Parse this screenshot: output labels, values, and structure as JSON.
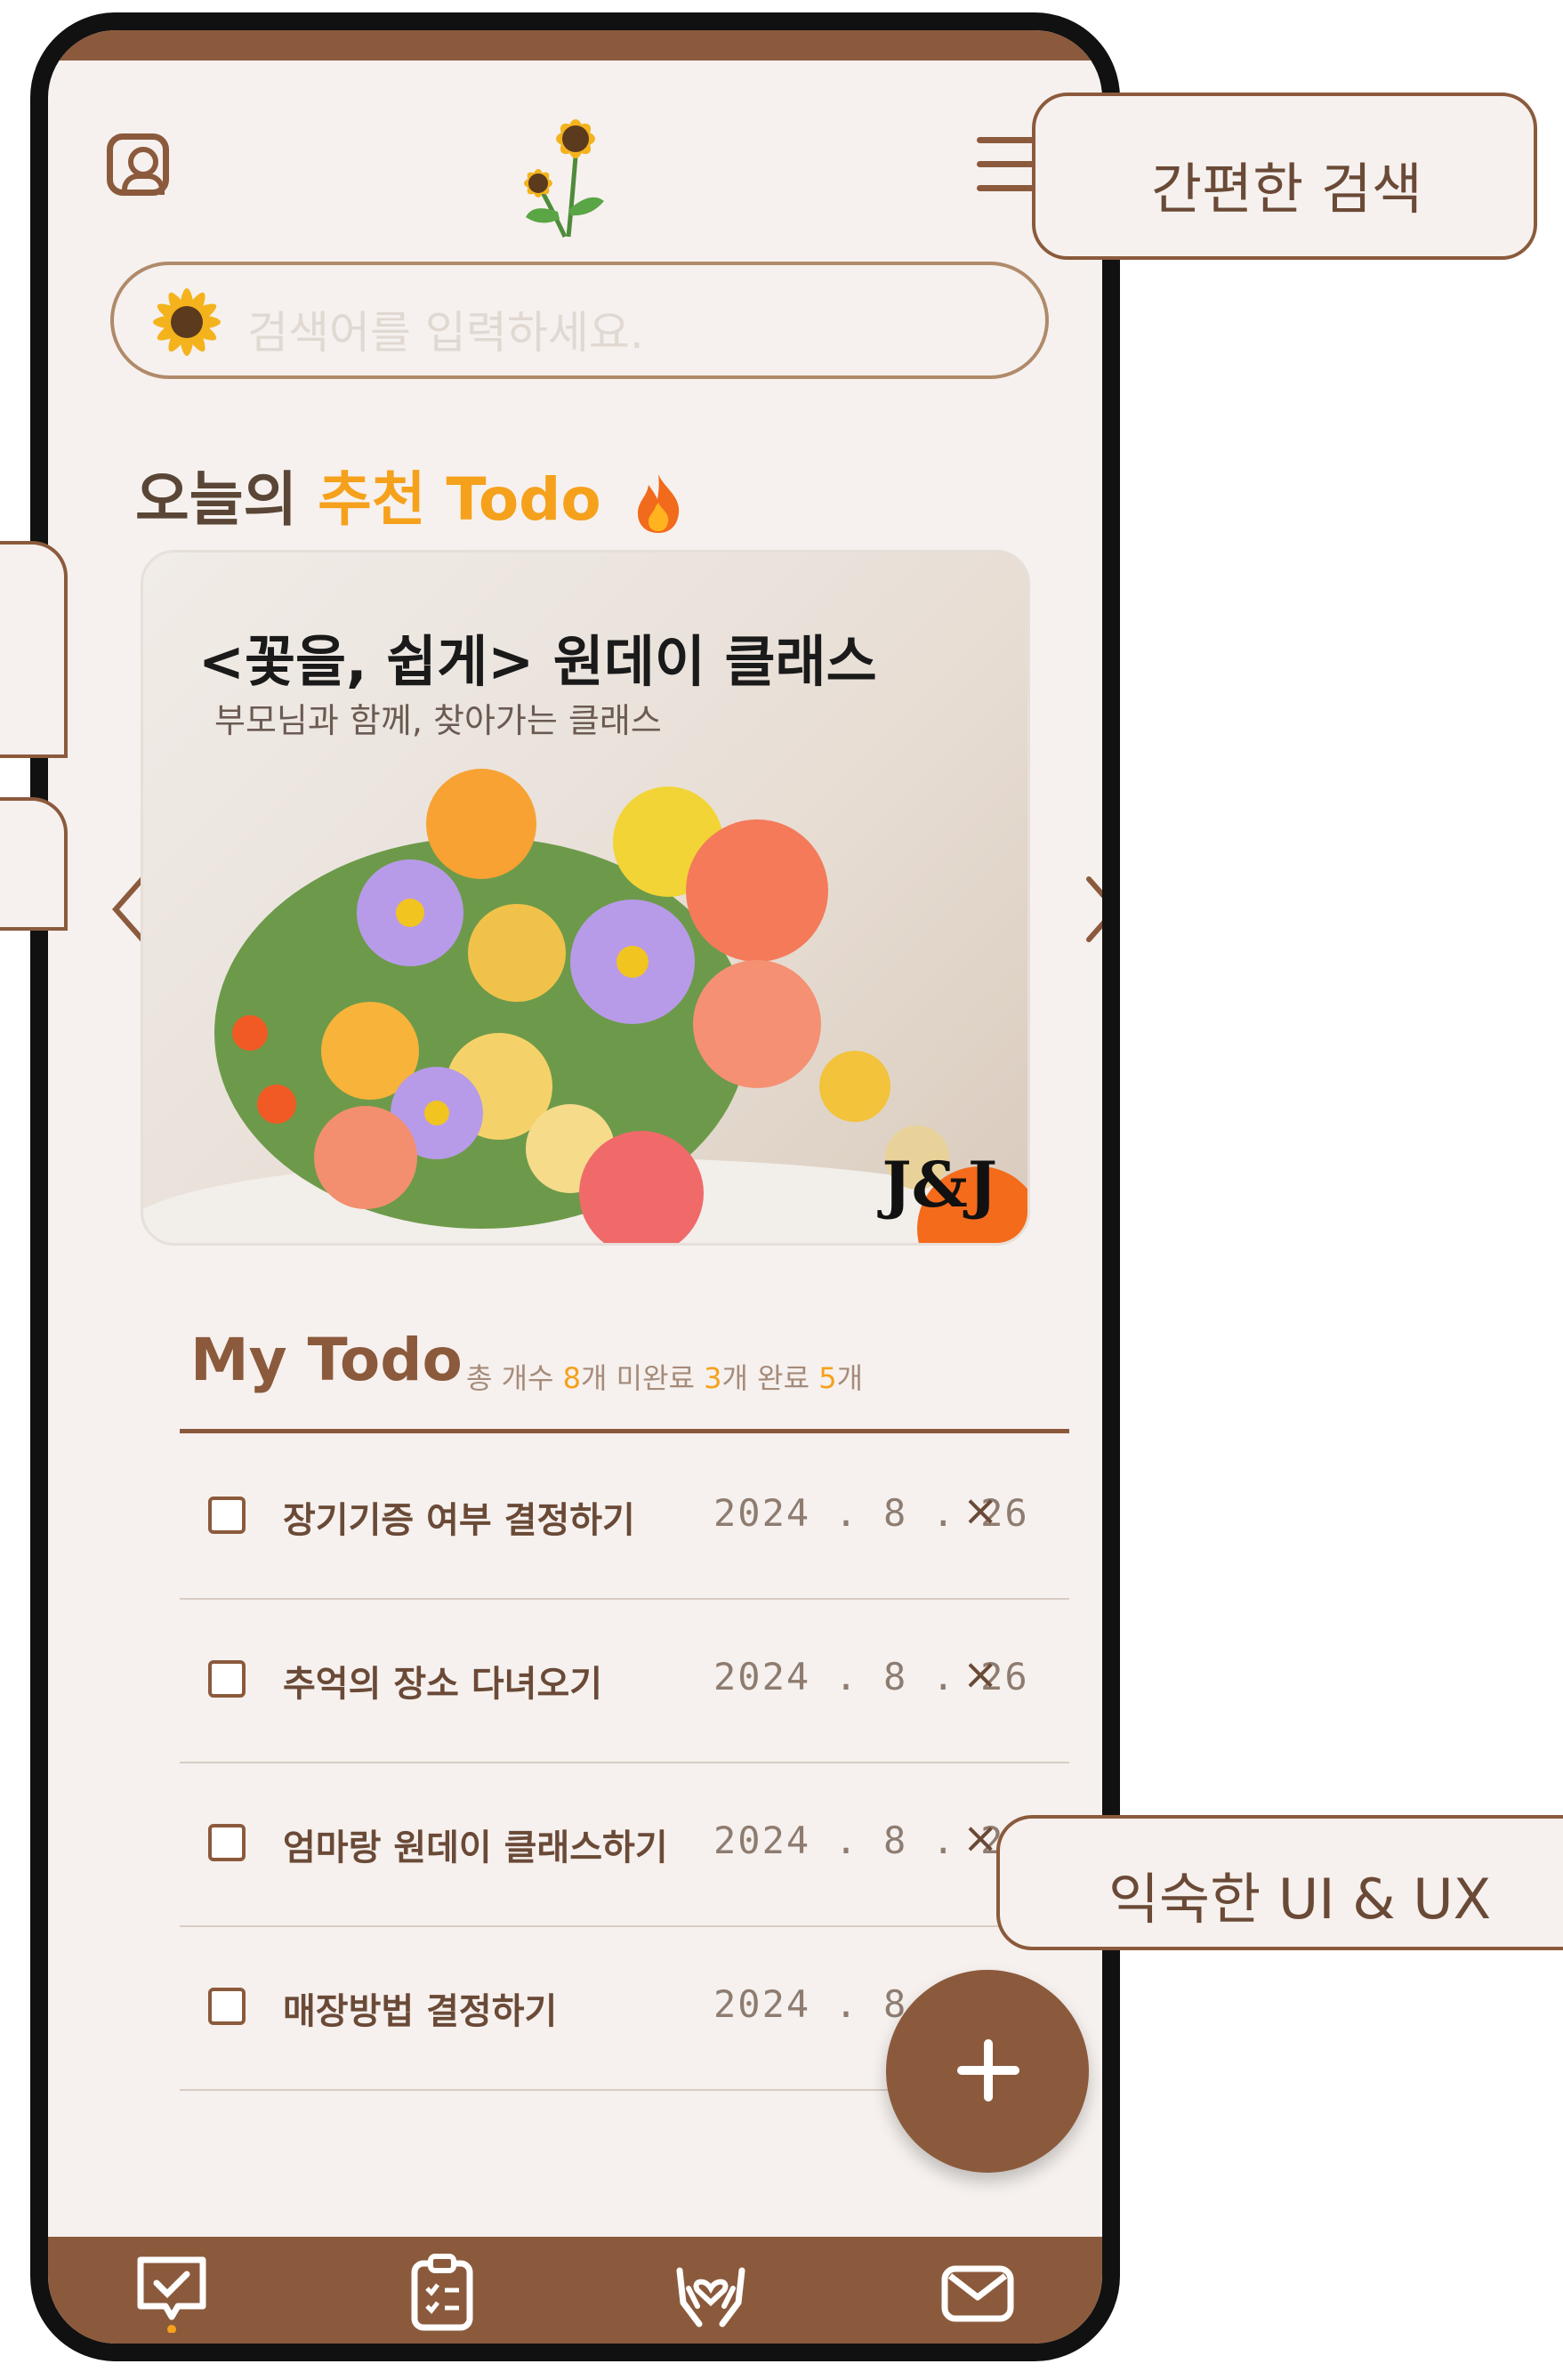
{
  "header": {
    "logo_icon": "sunflower-logo-icon",
    "profile_icon": "profile-icon",
    "menu_icon": "hamburger-menu-icon"
  },
  "search": {
    "placeholder": "검색어를 입력하세요.",
    "icon": "sunflower-search-icon"
  },
  "recommend": {
    "title_prefix": "오늘의 ",
    "title_accent": "추천 Todo",
    "icon": "fire-icon"
  },
  "banner": {
    "title": "<꽃을, 쉽게> 원데이 클래스",
    "subtitle": "부모님과 함께, 찾아가는 클래스",
    "brand": "J&J"
  },
  "my_todo": {
    "title": "My Todo",
    "stats": {
      "total_label": "총 개수",
      "total": "8",
      "unit1": "개",
      "incomplete_label": "미완료",
      "incomplete": "3",
      "unit2": "개",
      "complete_label": "완료",
      "complete": "5",
      "unit3": "개"
    },
    "items": [
      {
        "text": "장기기증 여부 결정하기",
        "date": "2024 . 8 . 26",
        "delete": "×"
      },
      {
        "text": "추억의 장소 다녀오기",
        "date": "2024 . 8 . 26",
        "delete": "×"
      },
      {
        "text": "엄마랑 원데이 클래스하기",
        "date": "2024 . 8 . 26",
        "delete": "×"
      },
      {
        "text": "매장방법 결정하기",
        "date": "2024 . 8 . 2",
        "delete": ""
      }
    ]
  },
  "fab": {
    "icon": "plus-icon"
  },
  "bottom_nav": {
    "items": [
      {
        "icon": "todo-check-icon",
        "active": true
      },
      {
        "icon": "clipboard-list-icon",
        "active": false
      },
      {
        "icon": "heart-hands-icon",
        "active": false
      },
      {
        "icon": "mail-icon",
        "active": false
      }
    ]
  },
  "callouts": {
    "search": "간편한 검색",
    "ui": "익숙한 UI & UX"
  },
  "colors": {
    "brand_brown": "#8b5a3c",
    "accent_orange": "#f5a11c",
    "background": "#f6f1ee"
  }
}
